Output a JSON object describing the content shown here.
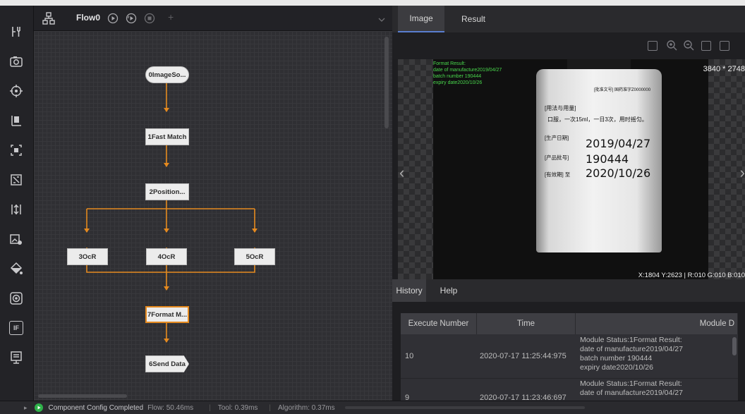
{
  "flow": {
    "title": "Flow0",
    "add_symbol": "+",
    "nodes": [
      "0ImageSo...",
      "1Fast Match",
      "2Position...",
      "3OcR",
      "4OcR",
      "5OcR",
      "7Format M...",
      "6Send Data"
    ]
  },
  "toolbar": {
    "items": [
      "tools-icon",
      "camera-icon",
      "target-icon",
      "locate-icon",
      "measure-icon",
      "recognition-icon",
      "calibration-icon",
      "image-process-icon",
      "color-icon",
      "defect-icon",
      "logic-if-icon",
      "communication-icon"
    ],
    "if_label": "IF"
  },
  "right_tabs": [
    "Image",
    "Result"
  ],
  "image": {
    "resolution": "3840 * 2748",
    "pixel_info": "X:1804 Y:2623 | R:010 G:010 B:010",
    "overlay": {
      "line1": "Format Result:",
      "line2": "date of manufacture2019/04/27",
      "line3": "batch number 190444",
      "line4": "expiry date2020/10/26"
    },
    "label": {
      "approval": "[批准文号] 国药准字Z0000000",
      "usage_title": "[用法与用量]",
      "usage_text": "口服，一次15ml，一日3次，用时摇匀。",
      "mfg_key": "[生产日期]",
      "mfg_val": "2019/04/27",
      "batch_key": "[产品批号]",
      "batch_val": "190444",
      "expiry_key": "[有效期] 至",
      "expiry_val": "2020/10/26"
    }
  },
  "history_tabs": [
    "History",
    "Help"
  ],
  "history": {
    "columns": [
      "Execute Number",
      "Time",
      "Module D"
    ],
    "rows": [
      {
        "number": "10",
        "time": "2020-07-17 11:25:44:975",
        "status": "Module Status:1Format Result:",
        "detail1": "date of manufacture2019/04/27",
        "detail2": "batch number 190444",
        "detail3": "expiry date2020/10/26"
      },
      {
        "number": "9",
        "time": "2020-07-17 11:23:46:697",
        "status": "Module Status:1Format Result:",
        "detail1": "date of manufacture2019/04/27"
      }
    ]
  },
  "status": {
    "message": "Component Config Completed",
    "flow_time": "Flow: 50.46ms",
    "tool_time": "Tool: 0.39ms",
    "algo_time": "Algorithm: 0.37ms"
  },
  "colors": {
    "accent": "#e58a1f",
    "overlay_text": "#49d84c",
    "tab_underline": "#5a7ed0",
    "run_icon": "#2fb24a"
  }
}
